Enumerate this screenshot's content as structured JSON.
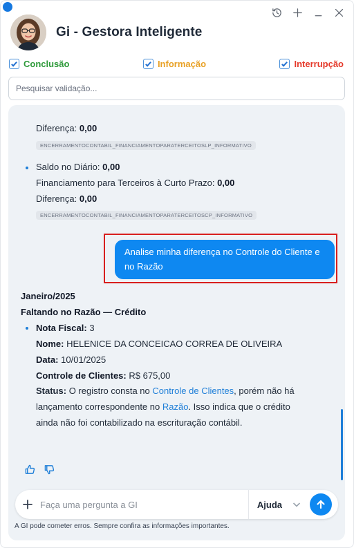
{
  "app": {
    "title": "Gi - Gestora Inteligente"
  },
  "window_controls": [
    "history-icon",
    "plus-icon",
    "minimize-icon",
    "close-icon"
  ],
  "filters": [
    {
      "label": "Conclusão",
      "checked": true,
      "color": "#2e9a3a"
    },
    {
      "label": "Informação",
      "checked": true,
      "color": "#e8a126"
    },
    {
      "label": "Interrupção",
      "checked": true,
      "color": "#e53a2b"
    }
  ],
  "search": {
    "placeholder": "Pesquisar validação..."
  },
  "chat": {
    "block1": {
      "diff_label": "Diferença:",
      "diff_value": "0,00",
      "tag": "ENCERRAMENTOCONTABIL_FINANCIAMENTOPARATERCEITOSLP_INFORMATIVO"
    },
    "block2": {
      "saldo_label": "Saldo no Diário:",
      "saldo_value": "0,00",
      "fin_label": "Financiamento para Terceiros à Curto Prazo:",
      "fin_value": "0,00",
      "diff_label": "Diferença:",
      "diff_value": "0,00",
      "tag": "ENCERRAMENTOCONTABIL_FINANCIAMENTOPARATERCEITOSCP_INFORMATIVO"
    },
    "user_message": "Analise minha diferença no Controle do Cliente e no Razão",
    "response": {
      "period": "Janeiro/2025",
      "section": "Faltando no Razão — Crédito",
      "nota_label": "Nota Fiscal:",
      "nota_value": "3",
      "nome_label": "Nome:",
      "nome_value": "HELENICE DA CONCEICAO CORREA DE OLIVEIRA",
      "data_label": "Data:",
      "data_value": "10/01/2025",
      "controle_label": "Controle de Clientes:",
      "controle_value": "R$ 675,00",
      "status_label": "Status:",
      "status_part1": "O registro consta no",
      "status_link1": "Controle de Clientes",
      "status_part2": ", porém não há",
      "status_part3": "lançamento correspondente no",
      "status_link2": "Razão",
      "status_part4": ". Isso indica que o crédito",
      "status_part5": "ainda não foi contabilizado na escrituração contábil."
    },
    "feedback": [
      "thumbs-up-icon",
      "thumbs-down-icon"
    ]
  },
  "composer": {
    "placeholder": "Faça uma pergunta a GI",
    "help_label": "Ajuda",
    "disclaimer": "A GI pode cometer erros. Sempre confira as informações importantes."
  },
  "colors": {
    "accent": "#0e88f1",
    "highlight_border": "#d81e1e",
    "panel_bg": "#eef2f6"
  }
}
